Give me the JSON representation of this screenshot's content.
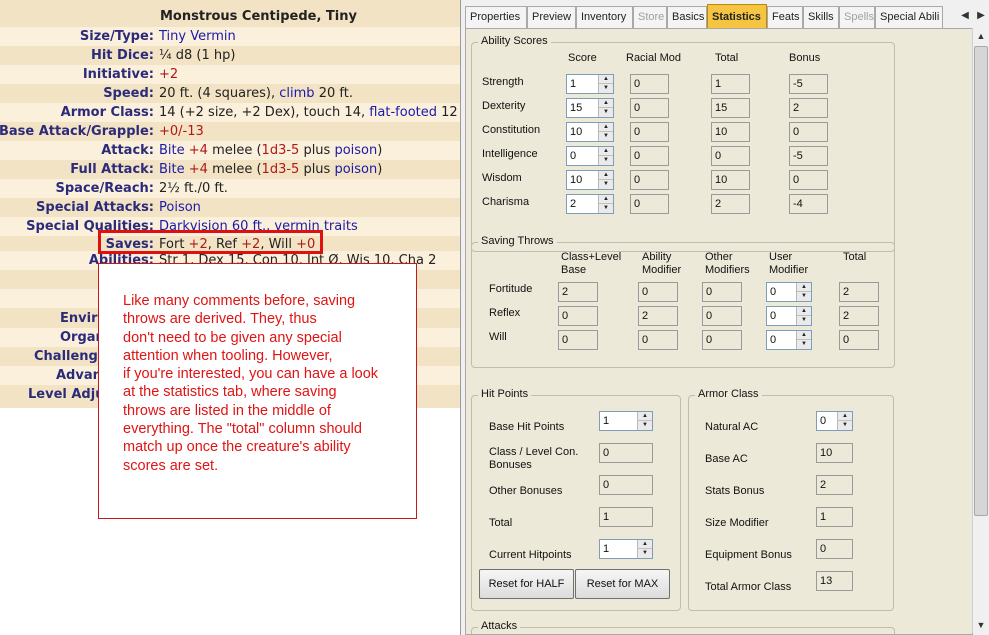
{
  "statblock": {
    "title": "Monstrous Centipede, Tiny",
    "rows": [
      {
        "label": "Size/Type:",
        "value": "Tiny Vermin"
      },
      {
        "label": "Hit Dice:",
        "value": "¼ d8 (1 hp)"
      },
      {
        "label": "Initiative:",
        "value": "+2"
      },
      {
        "label": "Speed:",
        "value_a": "20 ft. (4 squares), ",
        "value_link": "climb",
        "value_b": " 20 ft."
      },
      {
        "label": "Armor Class:",
        "value_a": "14 (+2 size, +2 Dex), touch 14, ",
        "value_link": "flat-footed",
        "value_b": " 12"
      },
      {
        "label": "Base Attack/Grapple:",
        "value": "+0/-13"
      },
      {
        "label": "Attack:",
        "link1": "Bite",
        "red1": " +4",
        "text1": " melee (",
        "red2": "1d3-5",
        "text2": " plus ",
        "link2": "poison",
        "text3": ")"
      },
      {
        "label": "Full Attack:",
        "link1": "Bite",
        "red1": " +4",
        "text1": " melee (",
        "red2": "1d3-5",
        "text2": " plus ",
        "link2": "poison",
        "text3": ")"
      },
      {
        "label": "Space/Reach:",
        "value": "2½ ft./0 ft."
      },
      {
        "label": "Special Attacks:",
        "value": "Poison"
      },
      {
        "label": "Special Qualities:",
        "value": "Darkvision 60 ft., vermin traits"
      },
      {
        "label": "Saves:",
        "text1": "Fort ",
        "red1": "+2",
        "text2": ", Ref ",
        "red2": "+2",
        "text3": ", Will ",
        "red3": "+0"
      },
      {
        "label": "Abilities:",
        "value": "Str 1, Dex 15, Con 10, Int Ø, Wis 10, Cha 2"
      }
    ],
    "truncated_labels": [
      "Enviro",
      "Organ",
      "Challenge",
      "Advance",
      "Level Adju"
    ]
  },
  "comment": {
    "text": "Like many comments before, saving\nthrows are derived. They, thus\ndon't need to be given any special\nattention when tooling. However,\nif you're interested, you can have a look\nat the statistics tab, where saving\nthrows are listed in the middle of\neverything. The \"total\" column should\nmatch up once the creature's ability\nscores are set."
  },
  "tabs": [
    {
      "label": "Properties",
      "disabled": false
    },
    {
      "label": "Preview",
      "disabled": false
    },
    {
      "label": "Inventory",
      "disabled": false
    },
    {
      "label": "Store",
      "disabled": true
    },
    {
      "label": "Basics",
      "disabled": false
    },
    {
      "label": "Statistics",
      "disabled": false,
      "active": true
    },
    {
      "label": "Feats",
      "disabled": false
    },
    {
      "label": "Skills",
      "disabled": false
    },
    {
      "label": "Spells",
      "disabled": true
    },
    {
      "label": "Special Abili",
      "disabled": false
    }
  ],
  "ability_scores": {
    "legend": "Ability Scores",
    "headers": {
      "score": "Score",
      "racial": "Racial Mod",
      "total": "Total",
      "bonus": "Bonus"
    },
    "rows": [
      {
        "name": "Strength",
        "score": "1",
        "racial": "0",
        "total": "1",
        "bonus": "-5"
      },
      {
        "name": "Dexterity",
        "score": "15",
        "racial": "0",
        "total": "15",
        "bonus": "2"
      },
      {
        "name": "Constitution",
        "score": "10",
        "racial": "0",
        "total": "10",
        "bonus": "0"
      },
      {
        "name": "Intelligence",
        "score": "0",
        "racial": "0",
        "total": "0",
        "bonus": "-5"
      },
      {
        "name": "Wisdom",
        "score": "10",
        "racial": "0",
        "total": "10",
        "bonus": "0"
      },
      {
        "name": "Charisma",
        "score": "2",
        "racial": "0",
        "total": "2",
        "bonus": "-4"
      }
    ]
  },
  "saving_throws": {
    "legend": "Saving Throws",
    "headers": {
      "base": "Class+Level\nBase",
      "ability": "Ability\nModifier",
      "other": "Other\nModifiers",
      "user": "User\nModifier",
      "total": "Total"
    },
    "rows": [
      {
        "name": "Fortitude",
        "base": "2",
        "ability": "0",
        "other": "0",
        "user": "0",
        "total": "2"
      },
      {
        "name": "Reflex",
        "base": "0",
        "ability": "2",
        "other": "0",
        "user": "0",
        "total": "2"
      },
      {
        "name": "Will",
        "base": "0",
        "ability": "0",
        "other": "0",
        "user": "0",
        "total": "0"
      }
    ]
  },
  "hit_points": {
    "legend": "Hit Points",
    "base_label": "Base Hit Points",
    "base_value": "1",
    "con_label": "Class / Level Con.\nBonuses",
    "con_value": "0",
    "other_label": "Other Bonuses",
    "other_value": "0",
    "total_label": "Total",
    "total_value": "1",
    "current_label": "Current Hitpoints",
    "current_value": "1",
    "reset_half": "Reset for HALF",
    "reset_max": "Reset for MAX"
  },
  "armor_class": {
    "legend": "Armor Class",
    "natural_label": "Natural AC",
    "natural_value": "0",
    "base_label": "Base AC",
    "base_value": "10",
    "stats_label": "Stats Bonus",
    "stats_value": "2",
    "size_label": "Size Modifier",
    "size_value": "1",
    "equip_label": "Equipment Bonus",
    "equip_value": "0",
    "total_label": "Total Armor Class",
    "total_value": "13"
  },
  "attacks": {
    "legend": "Attacks"
  },
  "colors": {
    "active_tab": "#f5c542",
    "statblock_bg": "#f3e3c5",
    "comment_red": "#e01414"
  }
}
